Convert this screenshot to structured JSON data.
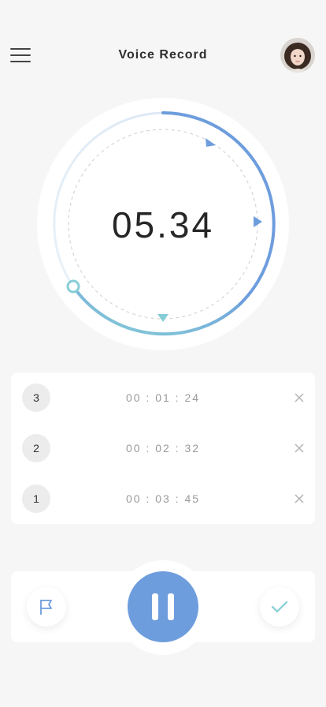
{
  "header": {
    "title": "Voice Record",
    "menu_icon": "hamburger-menu-icon",
    "avatar": "user-avatar"
  },
  "recorder": {
    "elapsed": "05.34",
    "colors": {
      "ring_start": "#e3ecf7",
      "ring_blue": "#6e9ddd",
      "ring_teal": "#86cdd6",
      "dashed": "#d6d6d6"
    }
  },
  "laps": [
    {
      "number": "3",
      "time": "00 : 01 : 24"
    },
    {
      "number": "2",
      "time": "00 : 02 : 32"
    },
    {
      "number": "1",
      "time": "00 : 03 : 45"
    }
  ],
  "controls": {
    "flag_icon": "flag-icon",
    "pause_icon": "pause-icon",
    "check_icon": "check-icon",
    "accent": "#6e9ddd",
    "check_color": "#86cdd6"
  }
}
